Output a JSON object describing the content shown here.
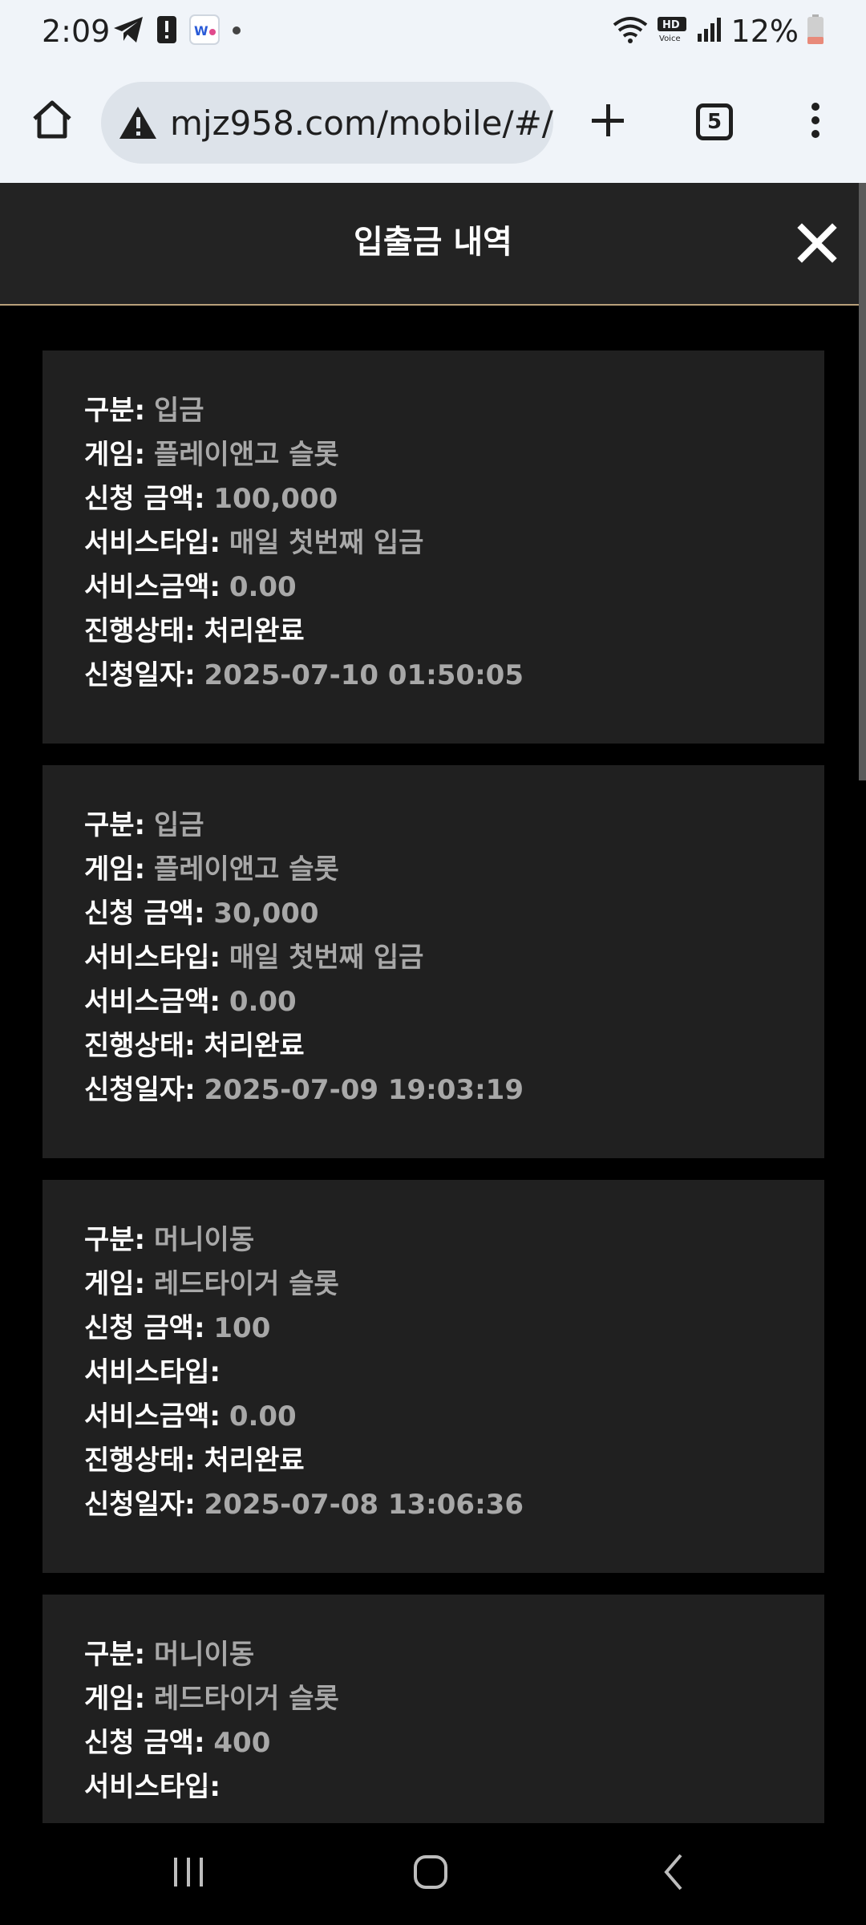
{
  "status_bar": {
    "time": "2:09",
    "battery": "12%",
    "icons": [
      "telegram-icon",
      "alert-icon",
      "app-icon",
      "dot-icon",
      "wifi-icon",
      "hd-voice-icon",
      "signal-icon",
      "battery-icon"
    ]
  },
  "browser": {
    "url": "mjz958.com/mobile/#/",
    "tab_count": "5"
  },
  "page": {
    "title": "입출금 내역"
  },
  "records": [
    {
      "type_label": "구분:",
      "type": "입금",
      "game_label": "게임:",
      "game": "플레이앤고 슬롯",
      "amount_label": "신청 금액:",
      "amount": "100,000",
      "service_type_label": "서비스타입:",
      "service_type": "매일 첫번째 입금",
      "service_amount_label": "서비스금액:",
      "service_amount": "0.00",
      "status_label": "진행상태:",
      "status": "처리완료",
      "date_label": "신청일자:",
      "date": "2025-07-10 01:50:05"
    },
    {
      "type_label": "구분:",
      "type": "입금",
      "game_label": "게임:",
      "game": "플레이앤고 슬롯",
      "amount_label": "신청 금액:",
      "amount": "30,000",
      "service_type_label": "서비스타입:",
      "service_type": "매일 첫번째 입금",
      "service_amount_label": "서비스금액:",
      "service_amount": "0.00",
      "status_label": "진행상태:",
      "status": "처리완료",
      "date_label": "신청일자:",
      "date": "2025-07-09 19:03:19"
    },
    {
      "type_label": "구분:",
      "type": "머니이동",
      "game_label": "게임:",
      "game": "레드타이거 슬롯",
      "amount_label": "신청 금액:",
      "amount": "100",
      "service_type_label": "서비스타입:",
      "service_type": "",
      "service_amount_label": "서비스금액:",
      "service_amount": "0.00",
      "status_label": "진행상태:",
      "status": "처리완료",
      "date_label": "신청일자:",
      "date": "2025-07-08 13:06:36"
    },
    {
      "type_label": "구분:",
      "type": "머니이동",
      "game_label": "게임:",
      "game": "레드타이거 슬롯",
      "amount_label": "신청 금액:",
      "amount": "400",
      "service_type_label": "서비스타입:",
      "service_type": ""
    }
  ],
  "colors": {
    "header_bg": "#232323",
    "card_bg": "#202020",
    "divider": "#b8a07a",
    "value_text": "#a8a8a8"
  }
}
